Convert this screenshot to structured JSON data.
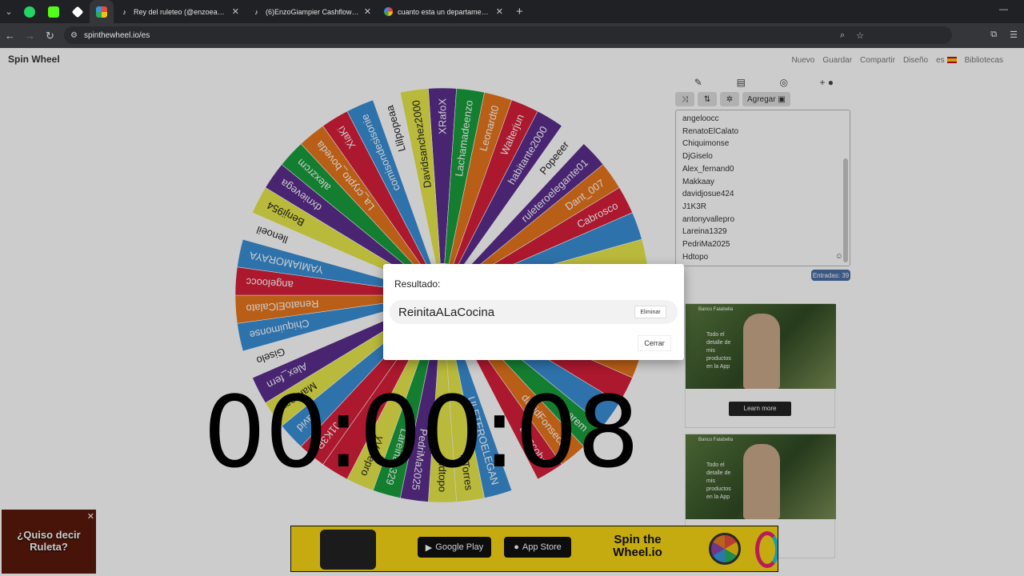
{
  "browser": {
    "tabs": [
      {
        "title": "Rey del ruleteo (@enzoeasycas",
        "favicon": "tiktok-icon"
      },
      {
        "title": "(6)EnzoGiampier Cashflow (@e",
        "favicon": "tiktok-icon"
      },
      {
        "title": "cuanto esta un departamento e",
        "favicon": "google-icon"
      }
    ],
    "url": "spinthewheel.io/es"
  },
  "site": {
    "logo": "Spin Wheel",
    "nav": [
      "Nuevo",
      "Guardar",
      "Compartir",
      "Diseño",
      "es",
      "Bibliotecas"
    ]
  },
  "wheel": {
    "segments": [
      "XRafoX",
      "Lachamadeenzo",
      "Leonardt0",
      "Walterjun",
      "habitante2000",
      "Popeeer",
      "ruleteroelegante01",
      "Dant_007",
      "Cabrosco",
      "",
      "",
      "",
      "",
      "",
      "",
      "",
      "",
      "arem",
      "davidFonsecaf",
      "aroscoba",
      "",
      "ULETEROELEGAN",
      "isTorres",
      "Hdtopo",
      "PedriMa2025",
      "Lareina1329",
      "yVallepro",
      "",
      "J1K3R",
      "david",
      "Makkaay",
      "Alex_fern",
      "Giselo",
      "Chiquimonse",
      "RenatoElCalato",
      "angeloocc",
      "YAMIAMORAYA",
      "llenoeil",
      "Benji954",
      "dxnievega",
      "alexzrcm",
      "La_crypto_boveda",
      "XiaKi",
      "comisondesisonie",
      "Llilpopeaa",
      "Davidsanchez2000"
    ],
    "colors": [
      "#5b2d8e",
      "#1a9e3c",
      "#e8761c",
      "#d81e3a",
      "#5b2d8e",
      "#ffffff",
      "#5b2d8e",
      "#e8761c",
      "#d81e3a",
      "#3a8fd6",
      "#e8e84a",
      "#ffffff",
      "#5b2d8e",
      "#1a9e3c",
      "#e8761c",
      "#d81e3a",
      "#3a8fd6",
      "#1a9e3c",
      "#e8761c",
      "#d81e3a",
      "#ffffff",
      "#3a8fd6",
      "#e8e84a",
      "#e8e84a",
      "#5b2d8e",
      "#1a9e3c",
      "#e8e84a",
      "#d81e3a",
      "#d81e3a",
      "#3a8fd6",
      "#e8e84a",
      "#5b2d8e",
      "#ffffff",
      "#3a8fd6",
      "#e8761c",
      "#d81e3a",
      "#3a8fd6",
      "#ffffff",
      "#e8e84a",
      "#5b2d8e",
      "#1a9e3c",
      "#e8761c",
      "#d81e3a",
      "#3a8fd6",
      "#ffffff",
      "#e8e84a"
    ]
  },
  "sidebar": {
    "add_label": "Agregar",
    "entries": [
      "angeloocc",
      "RenatoElCalato",
      "Chiquimonse",
      "DjGiselo",
      "Alex_fernand0",
      "Makkaay",
      "davidjosue424",
      "J1K3R",
      "antonyvallepro",
      "Lareina1329",
      "PedriMa2025",
      "Hdtopo"
    ],
    "entries_count": "Entradas: 39"
  },
  "ads": [
    {
      "brand": "Banco Falabella",
      "text": "Todo el detalle de mis productos en la App",
      "button": "Learn more"
    },
    {
      "brand": "Banco Falabella",
      "text": "Todo el detalle de mis productos en la App"
    }
  ],
  "banner": {
    "google_play": "Google Play",
    "app_store": "App Store",
    "brand": "Spin the Wheel.io"
  },
  "promo": {
    "text": "¿Quiso decir Ruleta?"
  },
  "modal": {
    "title": "Resultado:",
    "result": "ReinitaALaCocina",
    "delete_label": "Eliminar",
    "close_label": "Cerrar"
  },
  "timer": "00:00:08"
}
